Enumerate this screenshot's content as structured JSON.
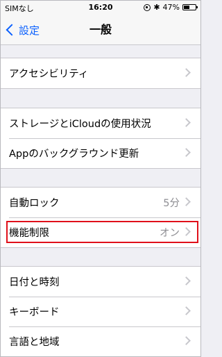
{
  "status_bar": {
    "carrier": "SIMなし",
    "time": "16:20",
    "battery": "47%",
    "battery_level": 0.47
  },
  "nav": {
    "back_label": "設定",
    "title": "一般"
  },
  "groups": [
    {
      "rows": [
        {
          "label": "アクセシビリティ",
          "value": ""
        }
      ]
    },
    {
      "rows": [
        {
          "label": "ストレージとiCloudの使用状況",
          "value": ""
        },
        {
          "label": "Appのバックグラウンド更新",
          "value": ""
        }
      ]
    },
    {
      "rows": [
        {
          "label": "自動ロック",
          "value": "5分"
        },
        {
          "label": "機能制限",
          "value": "オン"
        }
      ]
    },
    {
      "rows": [
        {
          "label": "日付と時刻",
          "value": ""
        },
        {
          "label": "キーボード",
          "value": ""
        },
        {
          "label": "言語と地域",
          "value": ""
        }
      ]
    }
  ]
}
